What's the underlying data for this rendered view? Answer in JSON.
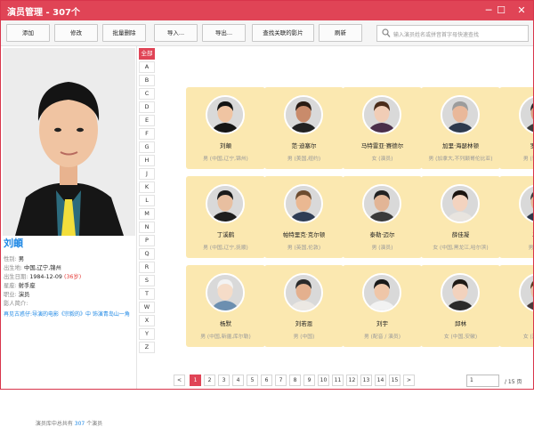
{
  "window": {
    "title": "演员管理 - 307个",
    "controls": [
      "─",
      "☐",
      "✕"
    ]
  },
  "toolbar": {
    "add": "添加",
    "edit": "修改",
    "batch_delete": "批量删除",
    "import": "导入...",
    "export": "导出...",
    "find_movies": "查找关联的影片",
    "refresh": "刷新",
    "search_placeholder": "输入演员姓名或拼音首字母快速查找"
  },
  "actor": {
    "name": "刘頔",
    "gender_label": "性别:",
    "gender": "男",
    "birthplace_label": "出生地:",
    "birthplace": "中国,辽宁,锦州",
    "birthdate_label": "出生日期:",
    "birthdate": "1984-12-09",
    "age": "(36岁)",
    "zodiac_label": "星座:",
    "zodiac": "射手座",
    "job_label": "职业:",
    "job": "演员",
    "bio_label": "影人简介:",
    "bio": "再见古惑仔:导演的电影《宗毅的》中 饰演青岛山一角"
  },
  "footer": {
    "prefix": "演员库中总共有",
    "count": "307",
    "suffix": "个演员"
  },
  "alphabet": [
    "全部",
    "A",
    "B",
    "C",
    "D",
    "E",
    "F",
    "G",
    "H",
    "J",
    "K",
    "L",
    "M",
    "N",
    "P",
    "Q",
    "R",
    "S",
    "T",
    "W",
    "X",
    "Y",
    "Z"
  ],
  "selected_letter": "全部",
  "actors": [
    {
      "name": "刘頔",
      "desc": "男 (中国,辽宁,锦州)"
    },
    {
      "name": "范·迪塞尔",
      "desc": "男 (美国,纽约)"
    },
    {
      "name": "马特雷亚·赛德尔",
      "desc": "女 (演员)"
    },
    {
      "name": "加里·海瑟林顿",
      "desc": "男 (加拿大,不列颠哥伦比亚)"
    },
    {
      "name": "罗伯托",
      "desc": "男 (哥伦比亚)"
    },
    {
      "name": "丁溪鹤",
      "desc": "男 (中国,辽宁,抚顺)"
    },
    {
      "name": "帕特里克·克尔顿",
      "desc": "男 (英国,伦敦)"
    },
    {
      "name": "泰勒·迈尔",
      "desc": "男 (演员)"
    },
    {
      "name": "薛佳凝",
      "desc": "女 (中国,黑龙江,哈尔滨)"
    },
    {
      "name": "马克·",
      "desc": "男 (美国)"
    },
    {
      "name": "杨默",
      "desc": "男 (中国,新疆,库尔勒)"
    },
    {
      "name": "刘若恩",
      "desc": "男 (中国)"
    },
    {
      "name": "刘宇",
      "desc": "男 (配音 / 演员)"
    },
    {
      "name": "邱林",
      "desc": "女 (中国,安徽)"
    },
    {
      "name": "菲比",
      "desc": "女 (澳大利亚)"
    }
  ],
  "pagination": {
    "prev": "<",
    "next": ">",
    "pages": [
      "1",
      "2",
      "3",
      "4",
      "5",
      "6",
      "7",
      "8",
      "9",
      "10",
      "11",
      "12",
      "13",
      "14",
      "15"
    ],
    "current": "1",
    "input_value": "1",
    "total": "/ 15 页"
  }
}
